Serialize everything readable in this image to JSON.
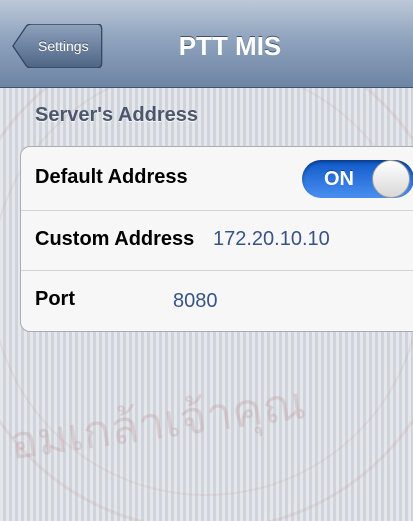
{
  "navbar": {
    "back_label": "Settings",
    "title": "PTT MIS"
  },
  "section": {
    "header": "Server's Address"
  },
  "rows": {
    "default_address": {
      "label": "Default Address",
      "toggle_text": "ON",
      "toggle_on": true
    },
    "custom_address": {
      "label": "Custom Address",
      "value": "172.20.10.10"
    },
    "port": {
      "label": "Port",
      "value": "8080"
    }
  },
  "watermark": {
    "text": "อมเกล้าเจ้าคุณ"
  },
  "colors": {
    "navbar": "#7d93b1",
    "toggle_on": "#1f6de0",
    "value_text": "#385487",
    "section_header": "#4c566c"
  }
}
